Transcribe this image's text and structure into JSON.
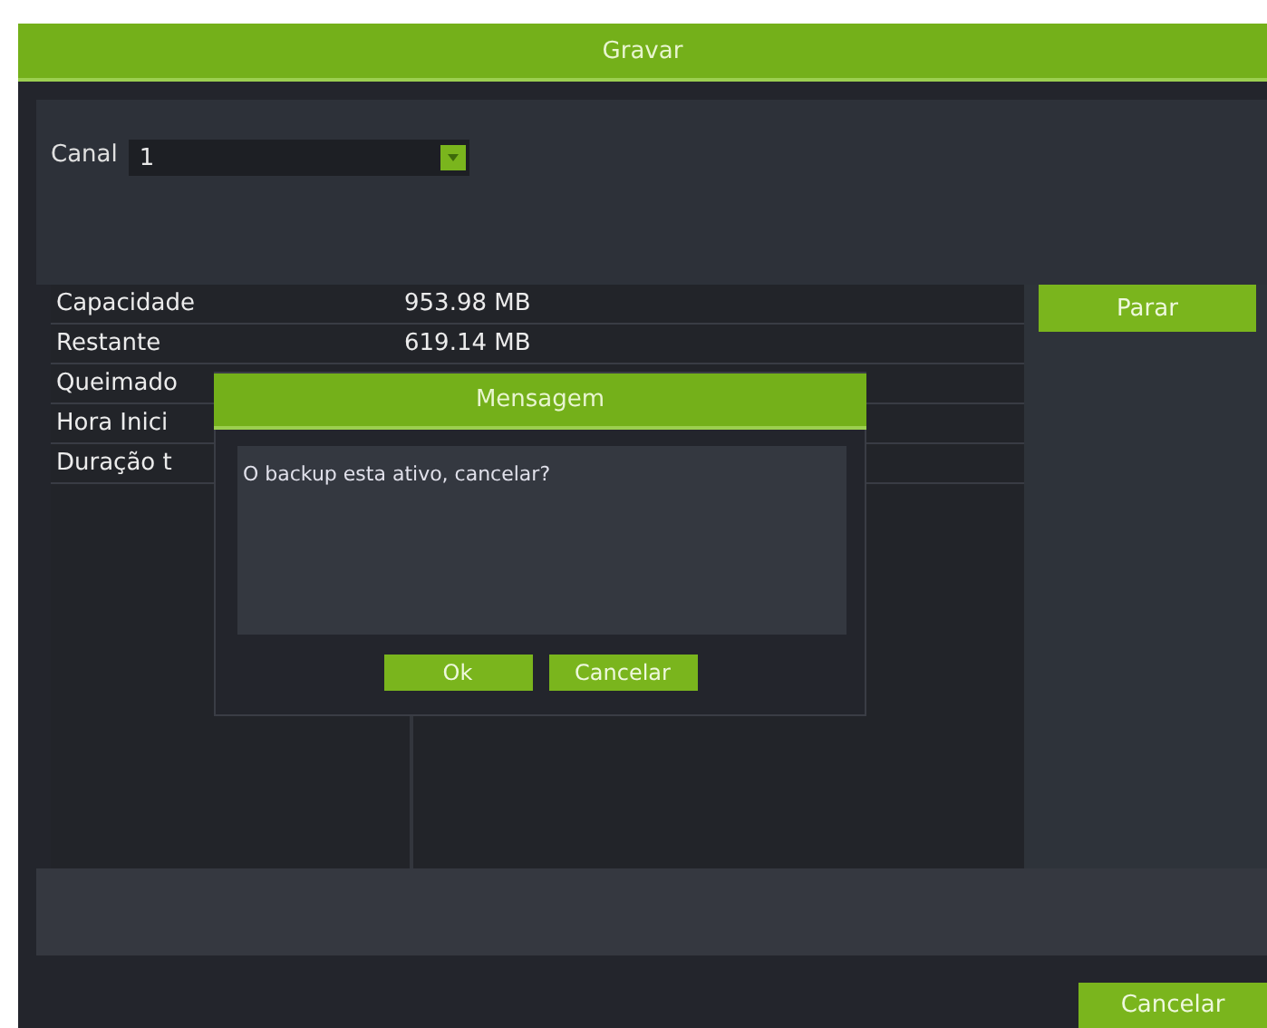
{
  "window": {
    "title": "Gravar"
  },
  "channel": {
    "label": "Canal",
    "value": "1"
  },
  "info_rows": [
    {
      "label": "Capacidade",
      "value": "953.98 MB"
    },
    {
      "label": "Restante",
      "value": "619.14 MB"
    },
    {
      "label": "Queimado"
    },
    {
      "label": "Hora Inici"
    },
    {
      "label": "Duração t"
    }
  ],
  "stop_button": "Parar",
  "cancel_button": "Cancelar",
  "dialog": {
    "title": "Mensagem",
    "message": "O backup esta ativo, cancelar?",
    "buttons": [
      "Ok",
      "Cancelar"
    ]
  }
}
